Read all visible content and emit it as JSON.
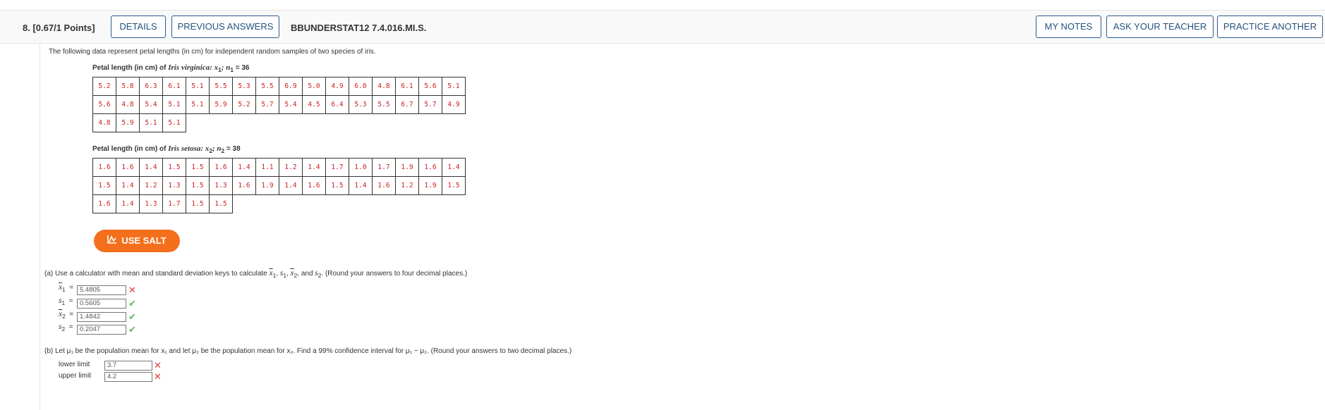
{
  "header": {
    "question": "8. [0.67/1 Points]",
    "details": "DETAILS",
    "previous_answers": "PREVIOUS ANSWERS",
    "assignment": "BBUNDERSTAT12 7.4.016.MI.S.",
    "my_notes": "MY NOTES",
    "ask_teacher": "ASK YOUR TEACHER",
    "practice_another": "PRACTICE ANOTHER"
  },
  "intro": "The following data represent petal lengths (in cm) for independent random samples of two species of iris.",
  "virginica": {
    "caption_prefix": "Petal length (in cm) of ",
    "species": "Iris virginica",
    "caption_suffix": ": x",
    "sub": "1",
    "n_label": "; n",
    "n_sub": "1",
    "n_value": " = 36",
    "rows": [
      [
        "5.2",
        "5.8",
        "6.3",
        "6.1",
        "5.1",
        "5.5",
        "5.3",
        "5.5",
        "6.9",
        "5.0",
        "4.9",
        "6.0",
        "4.8",
        "6.1",
        "5.6",
        "5.1"
      ],
      [
        "5.6",
        "4.8",
        "5.4",
        "5.1",
        "5.1",
        "5.9",
        "5.2",
        "5.7",
        "5.4",
        "4.5",
        "6.4",
        "5.3",
        "5.5",
        "6.7",
        "5.7",
        "4.9"
      ],
      [
        "4.8",
        "5.9",
        "5.1",
        "5.1"
      ]
    ]
  },
  "setosa": {
    "caption_prefix": "Petal length (in cm) of ",
    "species": "Iris setosa",
    "caption_suffix": ": x",
    "sub": "2",
    "n_label": "; n",
    "n_sub": "2",
    "n_value": " = 38",
    "rows": [
      [
        "1.6",
        "1.6",
        "1.4",
        "1.5",
        "1.5",
        "1.6",
        "1.4",
        "1.1",
        "1.2",
        "1.4",
        "1.7",
        "1.0",
        "1.7",
        "1.9",
        "1.6",
        "1.4"
      ],
      [
        "1.5",
        "1.4",
        "1.2",
        "1.3",
        "1.5",
        "1.3",
        "1.6",
        "1.9",
        "1.4",
        "1.6",
        "1.5",
        "1.4",
        "1.6",
        "1.2",
        "1.9",
        "1.5"
      ],
      [
        "1.6",
        "1.4",
        "1.3",
        "1.7",
        "1.5",
        "1.5"
      ]
    ]
  },
  "salt_label": "USE SALT",
  "part_a": {
    "text1": "(a)   Use a calculator with mean and standard deviation keys to calculate ",
    "text2": ", and ",
    "text3": ". (Round your answers to four decimal places.)",
    "fields": [
      {
        "label": "x",
        "sub": "1",
        "value": "5.4805",
        "status": "incorrect"
      },
      {
        "label": "s",
        "sub": "1",
        "value": "0.5605",
        "status": "correct"
      },
      {
        "label": "x",
        "sub": "2",
        "value": "1.4842",
        "status": "correct"
      },
      {
        "label": "s",
        "sub": "2",
        "value": "0.2047",
        "status": "correct"
      }
    ]
  },
  "part_b": {
    "text": "(b)   Let μ₁ be the population mean for x₁ and let μ₂ be the population mean for x₂. Find a 99% confidence interval for μ₁ − μ₂. (Round your answers to two decimal places.)",
    "lower_label": "lower limit",
    "lower_value": "3.7",
    "upper_label": "upper limit",
    "upper_value": "4.2"
  },
  "colors": {
    "button_border": "#2c5c8f",
    "salt": "#f46f1b",
    "data_text": "#cc1f1f",
    "correct": "#5cb85c",
    "incorrect": "#e03a3a"
  },
  "icons": {
    "salt": "salt-chart-icon",
    "correct": "checkmark-icon",
    "incorrect": "x-mark-icon"
  }
}
